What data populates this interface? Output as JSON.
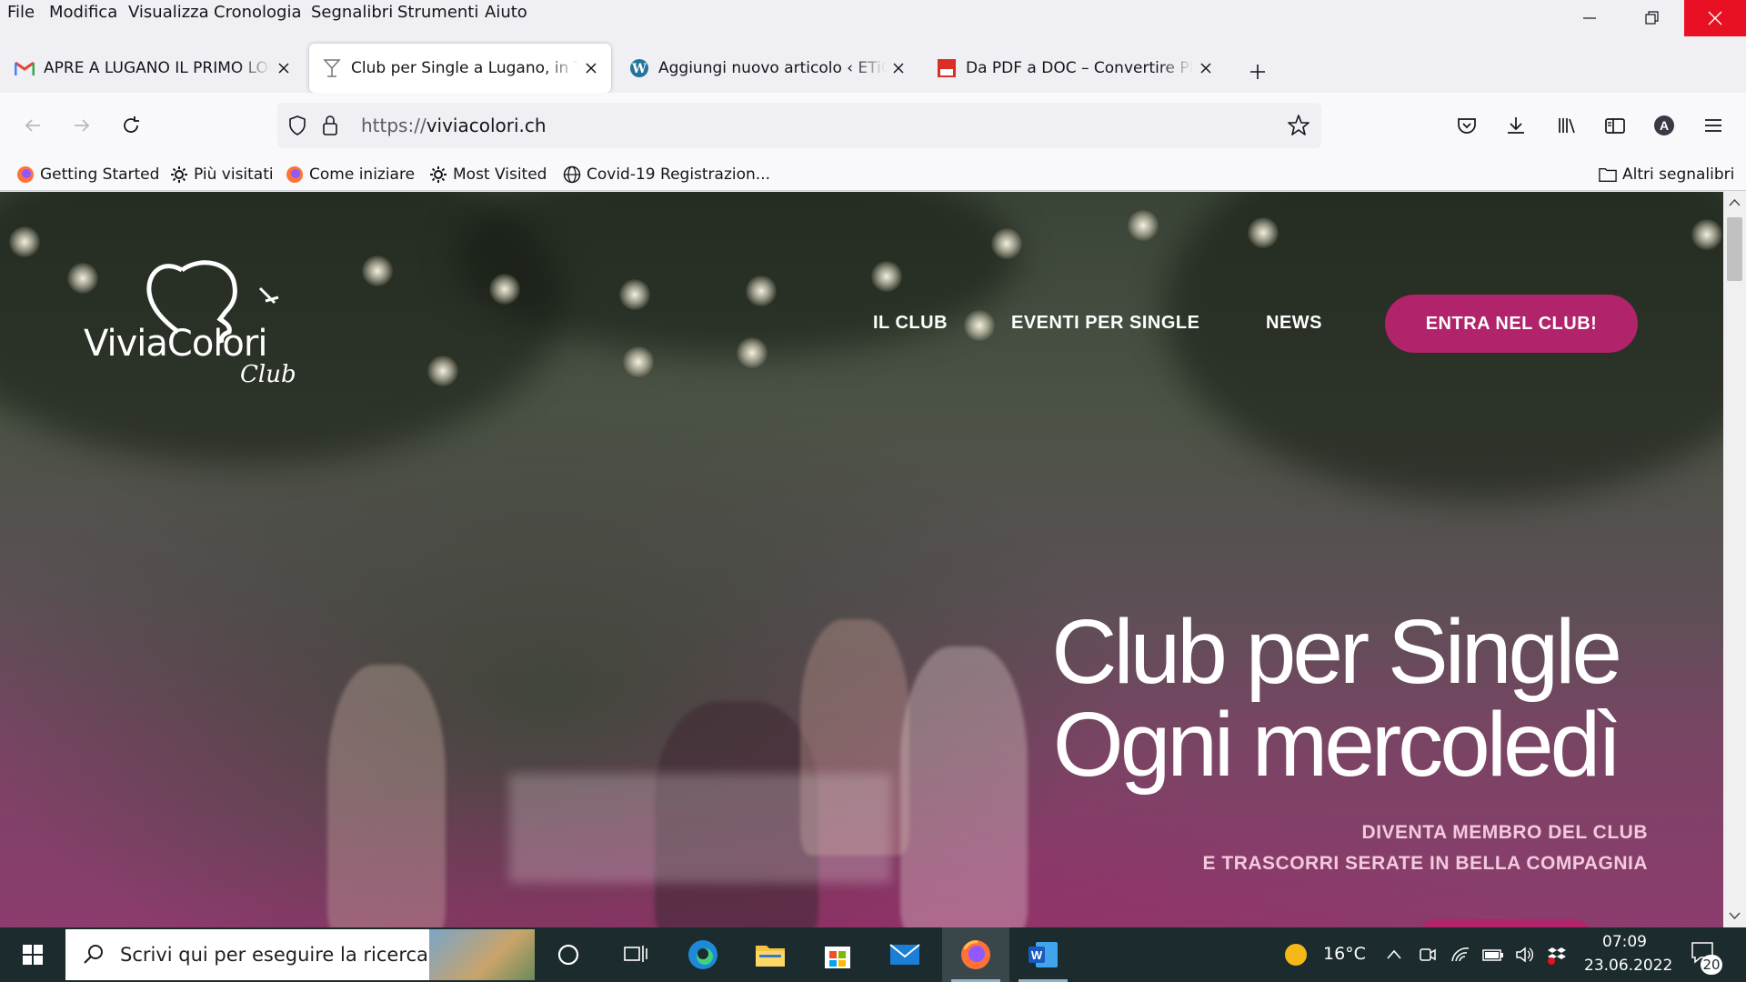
{
  "menubar": {
    "items": [
      "File",
      "Modifica",
      "Visualizza",
      "Cronologia",
      "Segnalibri",
      "Strumenti",
      "Aiuto"
    ]
  },
  "tabs": [
    {
      "title": "APRE A LUGANO IL PRIMO LOCALE",
      "icon": "gmail-icon",
      "selected": false
    },
    {
      "title": "Club per Single a Lugano, in Ticino",
      "icon": "cocktail-icon",
      "selected": true
    },
    {
      "title": "Aggiungi nuovo articolo ‹ ETiCinese",
      "icon": "wordpress-icon",
      "selected": false
    },
    {
      "title": "Da PDF a DOC – Convertire PDF",
      "icon": "pdf-icon",
      "selected": false
    }
  ],
  "navbar": {
    "url_scheme": "https://",
    "url_host": "viviacolori.ch"
  },
  "bookmarks": {
    "items": [
      {
        "label": "Getting Started",
        "icon": "firefox-icon"
      },
      {
        "label": "Più visitati",
        "icon": "gear-icon"
      },
      {
        "label": "Come iniziare",
        "icon": "firefox-icon"
      },
      {
        "label": "Most Visited",
        "icon": "gear-icon"
      },
      {
        "label": "Covid-19 Registrazion...",
        "icon": "globe-icon"
      }
    ],
    "other_label": "Altri segnalibri"
  },
  "site": {
    "logo_word": "ViviaColori",
    "logo_sub": "Club",
    "nav": [
      "IL CLUB",
      "EVENTI PER SINGLE",
      "NEWS"
    ],
    "cta": "ENTRA NEL CLUB!",
    "hero_line1": "Club per Single",
    "hero_line2": "Ogni mercoledì",
    "sub_line1": "DIVENTA MEMBRO DEL CLUB",
    "sub_line2": "E TRASCORRI SERATE IN BELLA COMPAGNIA",
    "brand_color": "#b1236b"
  },
  "taskbar": {
    "search_placeholder": "Scrivi qui per eseguire la ricerca",
    "apps": [
      "cortana-icon",
      "task-view-icon",
      "edge-icon",
      "file-explorer-icon",
      "store-icon",
      "mail-icon",
      "firefox-icon",
      "word-icon"
    ],
    "temperature": "16°C",
    "time": "07:09",
    "date": "23.06.2022",
    "notifications": "20"
  }
}
